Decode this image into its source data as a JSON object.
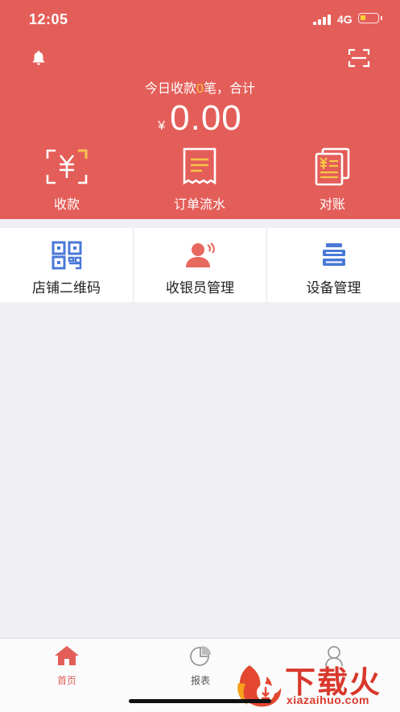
{
  "status_bar": {
    "time": "12:05",
    "network": "4G"
  },
  "header": {
    "summary_prefix": "今日收款",
    "summary_count": "0",
    "summary_suffix": "笔，合计",
    "currency": "¥",
    "amount": "0.00",
    "icons": {
      "left": "bell-icon",
      "right": "scan-icon"
    }
  },
  "quick_actions": [
    {
      "label": "收款",
      "icon": "receive-payment-icon"
    },
    {
      "label": "订单流水",
      "icon": "order-list-icon"
    },
    {
      "label": "对账",
      "icon": "reconcile-icon"
    }
  ],
  "features": [
    {
      "label": "店铺二维码",
      "icon": "qr-code-icon"
    },
    {
      "label": "收银员管理",
      "icon": "cashier-icon"
    },
    {
      "label": "设备管理",
      "icon": "device-icon"
    }
  ],
  "tabbar": [
    {
      "label": "首页",
      "icon": "home-icon",
      "active": true
    },
    {
      "label": "报表",
      "icon": "report-icon",
      "active": false
    }
  ],
  "watermark": {
    "text": "下载火",
    "url": "xiazaihuo.com"
  },
  "colors": {
    "brand": "#e45e59",
    "accent_yellow": "#f6c545",
    "icon_blue": "#4a78d8",
    "icon_red": "#e7685f",
    "tab_active": "#e45e59",
    "tab_inactive": "#888888"
  }
}
